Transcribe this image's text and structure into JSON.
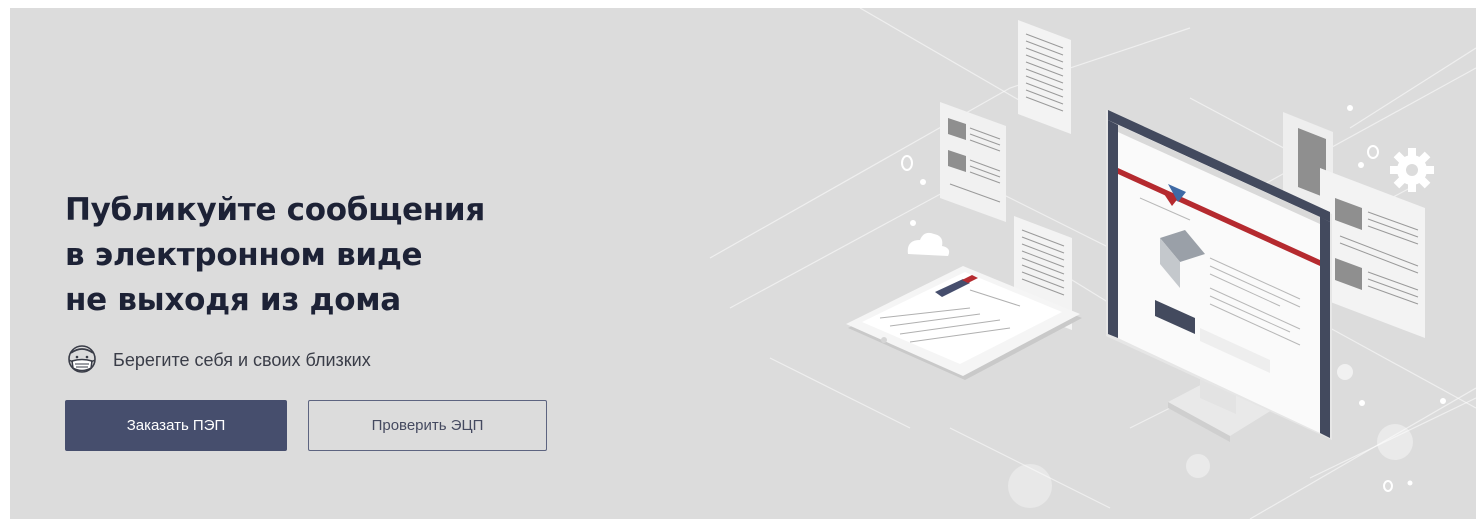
{
  "hero": {
    "headline_lines": [
      "Публикуйте сообщения",
      "в электронном виде",
      "не выходя из дома"
    ],
    "tagline": "Берегите себя и своих близких",
    "tagline_icon": "face-mask-icon"
  },
  "actions": {
    "primary_label": "Заказать ПЭП",
    "secondary_label": "Проверить ЭЦП"
  },
  "colors": {
    "background": "#dcdcdc",
    "primary_button": "#464e6d",
    "headline": "#1d2236",
    "accent_red": "#b52a2f"
  }
}
